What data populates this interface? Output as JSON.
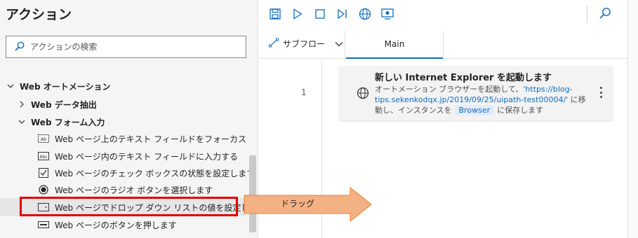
{
  "actions_pane": {
    "title": "アクション",
    "search_placeholder": "アクションの検索",
    "tree": {
      "web_automation": "Web オートメーション",
      "web_data_extraction": "Web データ抽出",
      "web_form_fill": "Web フォーム入力",
      "items": [
        {
          "label": "Web ページ上のテキスト フィールドをフォーカス",
          "icon": "text-field-focus-icon"
        },
        {
          "label": "Web ページ内のテキスト フィールドに入力する",
          "icon": "text-field-input-icon"
        },
        {
          "label": "Web ページのチェック ボックスの状態を設定します",
          "icon": "checkbox-icon"
        },
        {
          "label": "Web ページのラジオ ボタンを選択します",
          "icon": "radio-button-icon"
        },
        {
          "label": "Web ページでドロップ ダウン リストの値を設定します",
          "icon": "dropdown-list-icon"
        },
        {
          "label": "Web ページのボタンを押します",
          "icon": "button-icon"
        }
      ]
    }
  },
  "toolbar": {
    "buttons": [
      "save-icon",
      "run-icon",
      "stop-icon",
      "step-icon",
      "web-recorder-icon",
      "desktop-recorder-icon"
    ],
    "search_icon": "search-icon"
  },
  "tabs": {
    "subflow_label": "サブフロー",
    "main_label": "Main"
  },
  "editor": {
    "line_number": "1",
    "action": {
      "title": "新しい Internet Explorer を起動します",
      "desc_prefix": "オートメーション ブラウザーを起動して、",
      "url": "'https://blog-tips.sekenkodqx.jp/2019/09/25/uipath-test00004/'",
      "desc_mid": " に移動し、インスタンスを",
      "variable": "Browser",
      "desc_suffix": "に保存します"
    }
  },
  "annotation": {
    "drag_label": "ドラッグ"
  },
  "colors": {
    "accent": "#0f6cbd",
    "highlight_border": "#e00000",
    "arrow_fill": "#f4b183",
    "arrow_stroke": "#ed7d31"
  }
}
